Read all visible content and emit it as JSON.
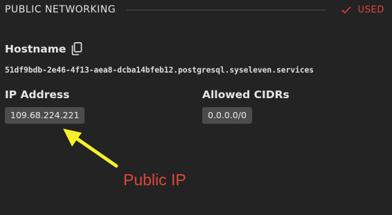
{
  "section": {
    "title": "PUBLIC NETWORKING",
    "status_label": "USED",
    "status_icon": "checkmark-icon",
    "status_color": "#e2453f"
  },
  "hostname": {
    "label": "Hostname",
    "copy_icon": "copy-icon",
    "value": "51df9bdb-2e46-4f13-aea8-dcba14bfeb12.postgresql.syseleven.services"
  },
  "ip_address": {
    "label": "IP Address",
    "value": "109.68.224.221"
  },
  "allowed_cidrs": {
    "label": "Allowed CIDRs",
    "value": "0.0.0.0/0"
  },
  "annotation": {
    "text": "Public IP",
    "text_color": "#e0473c",
    "arrow_color": "#f5f22a"
  }
}
